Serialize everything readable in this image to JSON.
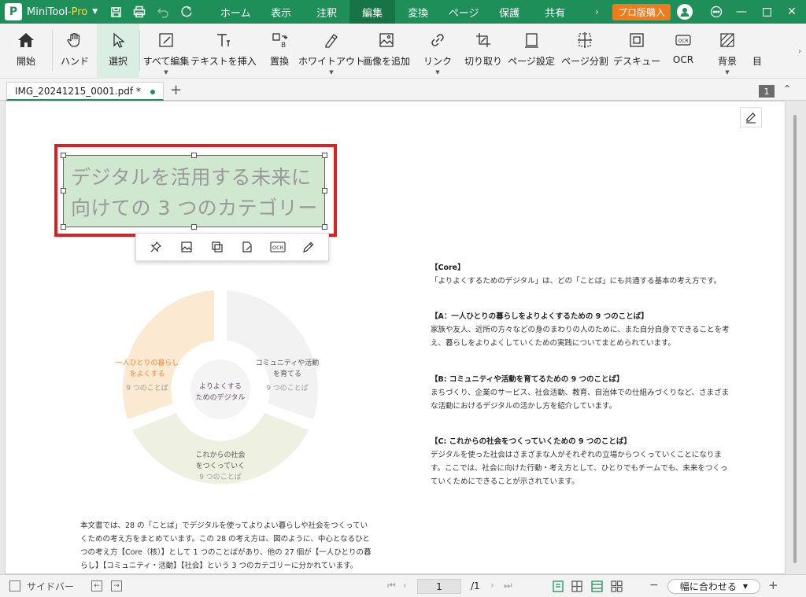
{
  "titlebar": {
    "app_name": "MiniTool",
    "app_suffix": "-Pro",
    "logo_letter": "P",
    "menus": [
      "ホーム",
      "表示",
      "注釈",
      "編集",
      "変換",
      "ページ",
      "保護",
      "共有"
    ],
    "active_menu": "編集",
    "buy_label": "プロ版購入",
    "accent_color": "#1f8f5a",
    "buy_color": "#f07b1d"
  },
  "ribbon": {
    "items": [
      {
        "label": "開始",
        "icon": "home-icon"
      },
      {
        "label": "ハンド",
        "icon": "hand-icon"
      },
      {
        "label": "選択",
        "icon": "cursor-icon"
      },
      {
        "label": "すべて編集",
        "icon": "edit-all-icon"
      },
      {
        "label": "テキストを挿入",
        "icon": "insert-text-icon"
      },
      {
        "label": "置換",
        "icon": "replace-icon"
      },
      {
        "label": "ホワイトアウト",
        "icon": "whiteout-icon"
      },
      {
        "label": "画像を追加",
        "icon": "add-image-icon"
      },
      {
        "label": "リンク",
        "icon": "link-icon"
      },
      {
        "label": "切り取り",
        "icon": "crop-icon"
      },
      {
        "label": "ページ設定",
        "icon": "page-setup-icon"
      },
      {
        "label": "ページ分割",
        "icon": "split-page-icon"
      },
      {
        "label": "デスキュー",
        "icon": "deskew-icon"
      },
      {
        "label": "OCR",
        "icon": "ocr-icon"
      },
      {
        "label": "背景",
        "icon": "background-icon"
      },
      {
        "label": "目",
        "icon": "more-icon"
      }
    ],
    "selected": "選択"
  },
  "tabs": {
    "doc_name": "IMG_20241215_0001.pdf *",
    "page_count_badge": "1"
  },
  "document": {
    "selected_text_line1": "デジタルを活用する未来に",
    "selected_text_line2": "向けての 3 つのカテゴリー",
    "diagram": {
      "segment_a_line1": "一人ひとりの暮らし",
      "segment_a_line2": "をよくする",
      "segment_a_sub": "9 つのことば",
      "segment_b_line1": "コミュニティや活動",
      "segment_b_line2": "を育てる",
      "segment_b_sub": "9 つのことば",
      "segment_c_line1": "これからの社会",
      "segment_c_line2": "をつくっていく",
      "segment_c_sub": "9 つのことば",
      "center_line1": "よりよくする",
      "center_line2": "ためのデジタル"
    },
    "sections": [
      {
        "title": "【Core】",
        "body": "「よりよくするためのデジタル」は、どの「ことば」にも共通する基本の考え方です。"
      },
      {
        "title": "【A：一人ひとりの暮らしをよりよくするための 9 つのことば】",
        "body": "家族や友人、近所の方々などの身のまわりの人のために、また自分自身でできることを考え、暮らしをよりよくしていくための実践についてまとめられています。"
      },
      {
        "title": "【B: コミュニティや活動を育てるための 9 つのことば】",
        "body": "まちづくり、企業のサービス、社会活動、教育、自治体での仕組みづくりなど、さまざまな活動におけるデジタルの活かし方を紹介しています。"
      },
      {
        "title": "【C: これからの社会をつくっていくための 9 つのことば】",
        "body": "デジタルを使った社会はさまざまな人がそれぞれの立場からつくっていくことになります。ここでは、社会に向けた行動・考え方として、ひとりでもチームでも、未来をつくっていくためにできることが示されています。"
      }
    ],
    "bottom_text": "本文書では、28 の「ことば」でデジタルを使ってよりよい暮らしや社会をつくっていくための考え方をまとめています。この 28 の考え方は、図のように、中心となるひとつの考え方【Core（核）】として 1 つのことばがあり、他の 27 個が【一人ひとりの暮らし】【コミュニティ・活動】【社会】という 3 つのカテゴリーに分かれています。"
  },
  "floatbar": {
    "icons": [
      "pin-icon",
      "image-icon",
      "copy-icon",
      "edit-doc-icon",
      "ocr-icon",
      "pen-icon"
    ]
  },
  "statusbar": {
    "sidebar_label": "サイドバー",
    "current_page": "1",
    "total_pages": "/1",
    "zoom_label": "幅に合わせる"
  }
}
